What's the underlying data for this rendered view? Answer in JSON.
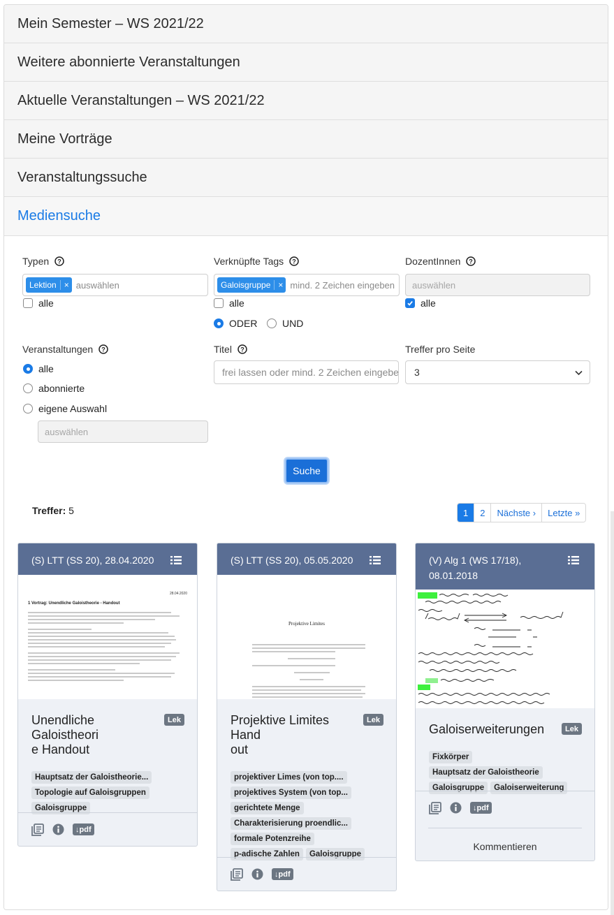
{
  "accordion": [
    {
      "label": "Mein Semester – WS 2021/22"
    },
    {
      "label": "Weitere abonnierte Veranstaltungen"
    },
    {
      "label": "Aktuelle Veranstaltungen – WS 2021/22"
    },
    {
      "label": "Meine Vorträge"
    },
    {
      "label": "Veranstaltungssuche"
    },
    {
      "label": "Mediensuche"
    }
  ],
  "form": {
    "typen": {
      "label": "Typen",
      "chip": "Lektion",
      "chip_remove": "×",
      "placeholder": "auswählen",
      "all_label": "alle",
      "all_checked": false
    },
    "tags": {
      "label": "Verknüpfte Tags",
      "chip": "Galoisgruppe",
      "chip_remove": "×",
      "placeholder": "mind. 2 Zeichen eingeben",
      "all_label": "alle",
      "all_checked": false,
      "oder_label": "ODER",
      "und_label": "UND",
      "selected": "ODER"
    },
    "dozenten": {
      "label": "DozentInnen",
      "placeholder": "auswählen",
      "all_label": "alle",
      "all_checked": true
    },
    "veranstaltungen": {
      "label": "Veranstaltungen",
      "options": [
        "alle",
        "abonnierte",
        "eigene Auswahl"
      ],
      "selected": "alle",
      "placeholder": "auswählen"
    },
    "titel": {
      "label": "Titel",
      "placeholder": "frei lassen oder mind. 2 Zeichen eingeben"
    },
    "treffer_pro_seite": {
      "label": "Treffer pro Seite",
      "value": "3"
    },
    "search_button": "Suche"
  },
  "results": {
    "label": "Treffer:",
    "count": "5",
    "pagination": {
      "pages": [
        "1",
        "2"
      ],
      "current": "1",
      "next": "Nächste ›",
      "last": "Letzte »"
    }
  },
  "cards": [
    {
      "header": "(S) LTT (SS 20), 28.04.2020",
      "thumb": {
        "date": "28.04.2020",
        "heading": "1   Vortrag: Unendliche Galoistheorie - Handout"
      },
      "title": "Unendliche Galoistheorie Handout",
      "title_l1": "Unendliche Galoistheori",
      "title_l2": "e Handout",
      "badge": "Lek",
      "tags": [
        "Hauptsatz der Galoistheorie...",
        "Topologie auf Galoisgruppen",
        "Galoisgruppe"
      ],
      "pdf": "↓pdf"
    },
    {
      "header": "(S) LTT (SS 20), 05.05.2020",
      "thumb": {
        "heading": "Projektive Limites"
      },
      "title_l1": "Projektive Limites Hand",
      "title_l2": "out",
      "badge": "Lek",
      "tags": [
        "projektiver Limes (von top....",
        "projektives System (von top...",
        "gerichtete Menge",
        "Charakterisierung proendlic...",
        "formale Potenzreihe",
        "p-adische Zahlen",
        "Galoisgruppe"
      ],
      "pdf": "↓pdf"
    },
    {
      "header_l1": "(V) Alg 1 (WS 17/18),",
      "header_l2": "08.01.2018",
      "title_l1": "Galoiserweiterungen",
      "badge": "Lek",
      "tags": [
        "Fixkörper",
        "Hauptsatz der Galoistheorie",
        "Galoisgruppe",
        "Galoiserweiterung"
      ],
      "pdf": "↓pdf",
      "comment": "Kommentieren"
    }
  ],
  "colors": {
    "accent": "#1a7be6",
    "card_header": "#5a6e94",
    "card_body": "#eef1f6",
    "badge": "#6c7682"
  }
}
